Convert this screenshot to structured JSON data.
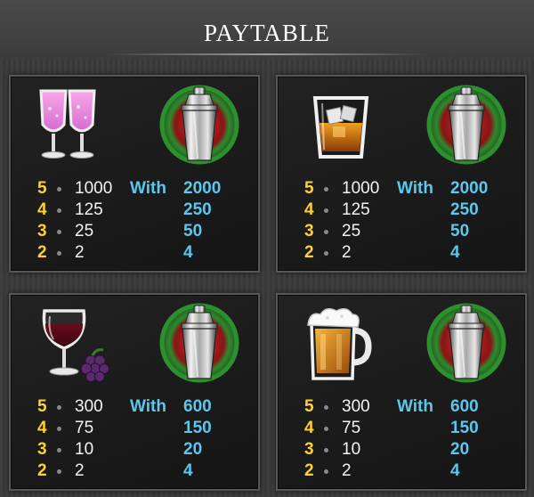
{
  "title": "PAYTABLE",
  "with_label": "With",
  "wild_symbol": "cocktail-shaker-icon",
  "colors": {
    "count": "#ffd22a",
    "payout": "#f4f4f4",
    "wild_payout": "#5cc7ec",
    "wild_ring": "#3a9a3a",
    "wild_center": "#b32020"
  },
  "panels": [
    {
      "symbol": "champagne-glasses-icon",
      "rows": [
        {
          "count": "5",
          "payout": "1000",
          "wild_payout": "2000"
        },
        {
          "count": "4",
          "payout": "125",
          "wild_payout": "250"
        },
        {
          "count": "3",
          "payout": "25",
          "wild_payout": "50"
        },
        {
          "count": "2",
          "payout": "2",
          "wild_payout": "4"
        }
      ]
    },
    {
      "symbol": "whiskey-glass-icon",
      "rows": [
        {
          "count": "5",
          "payout": "1000",
          "wild_payout": "2000"
        },
        {
          "count": "4",
          "payout": "125",
          "wild_payout": "250"
        },
        {
          "count": "3",
          "payout": "25",
          "wild_payout": "50"
        },
        {
          "count": "2",
          "payout": "2",
          "wild_payout": "4"
        }
      ]
    },
    {
      "symbol": "wine-glass-grapes-icon",
      "rows": [
        {
          "count": "5",
          "payout": "300",
          "wild_payout": "600"
        },
        {
          "count": "4",
          "payout": "75",
          "wild_payout": "150"
        },
        {
          "count": "3",
          "payout": "10",
          "wild_payout": "20"
        },
        {
          "count": "2",
          "payout": "2",
          "wild_payout": "4"
        }
      ]
    },
    {
      "symbol": "beer-mug-icon",
      "rows": [
        {
          "count": "5",
          "payout": "300",
          "wild_payout": "600"
        },
        {
          "count": "4",
          "payout": "75",
          "wild_payout": "150"
        },
        {
          "count": "3",
          "payout": "10",
          "wild_payout": "20"
        },
        {
          "count": "2",
          "payout": "2",
          "wild_payout": "4"
        }
      ]
    }
  ]
}
